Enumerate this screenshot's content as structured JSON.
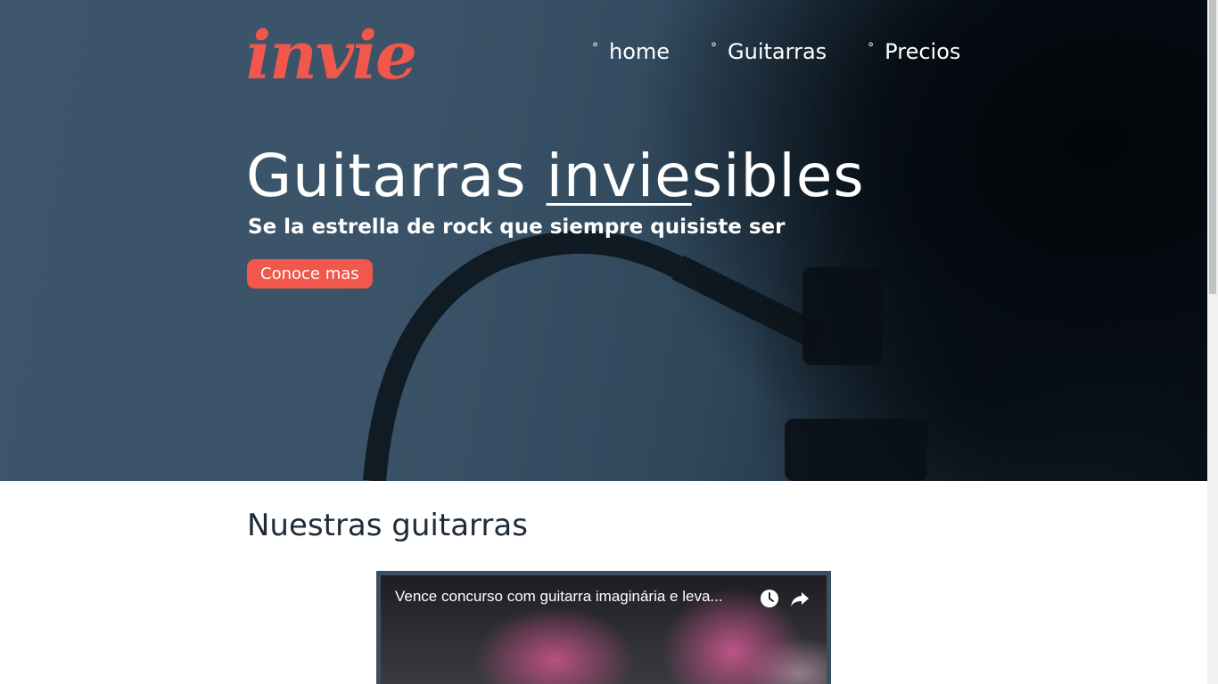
{
  "header": {
    "logo_text": "invie",
    "nav": [
      {
        "label": "home"
      },
      {
        "label": "Guitarras"
      },
      {
        "label": "Precios"
      }
    ]
  },
  "hero": {
    "title_before": "Guitarras ",
    "title_highlight": "invie",
    "title_after": "sibles",
    "subtitle": "Se la estrella de rock que siempre quisiste ser",
    "cta_label": "Conoce mas"
  },
  "guitars_section": {
    "title": "Nuestras guitarras",
    "video": {
      "title": "Vence concurso com guitarra imaginária e leva...",
      "icons": [
        "watch-later-icon",
        "share-icon"
      ]
    }
  },
  "colors": {
    "accent": "#f1574a",
    "hero_bg": "#3d556b",
    "text_dark": "#1f2b37"
  }
}
